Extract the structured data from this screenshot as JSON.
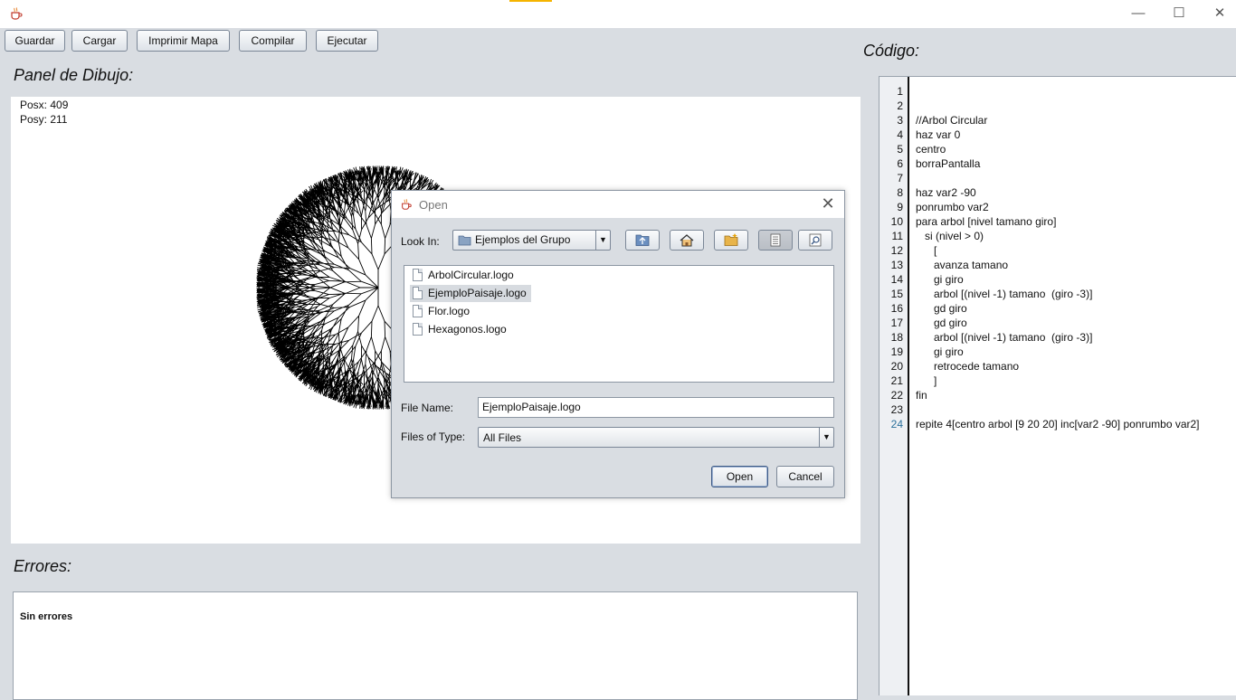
{
  "window": {
    "icon": "java-cup-icon",
    "controls": {
      "minimize": "—",
      "maximize": "☐",
      "close": "✕"
    }
  },
  "toolbar": {
    "guardar": "Guardar",
    "cargar": "Cargar",
    "imprimir": "Imprimir Mapa",
    "compilar": "Compilar",
    "ejecutar": "Ejecutar"
  },
  "drawing": {
    "title": "Panel de Dibujo:",
    "posx": "Posx: 409",
    "posy": "Posy: 211"
  },
  "errors": {
    "title": "Errores:",
    "message": "Sin errores"
  },
  "code": {
    "title": "Código:",
    "lines": [
      {
        "n": "1",
        "text": ""
      },
      {
        "n": "2",
        "text": ""
      },
      {
        "n": "3",
        "text": "//Arbol Circular"
      },
      {
        "n": "4",
        "text": "haz var 0"
      },
      {
        "n": "5",
        "text": "centro"
      },
      {
        "n": "6",
        "text": "borraPantalla"
      },
      {
        "n": "7",
        "text": ""
      },
      {
        "n": "8",
        "text": "haz var2 -90"
      },
      {
        "n": "9",
        "text": "ponrumbo var2"
      },
      {
        "n": "10",
        "text": "para arbol [nivel tamano giro]"
      },
      {
        "n": "11",
        "text": "   si (nivel > 0)"
      },
      {
        "n": "12",
        "text": "      ["
      },
      {
        "n": "13",
        "text": "      avanza tamano"
      },
      {
        "n": "14",
        "text": "      gi giro"
      },
      {
        "n": "15",
        "text": "      arbol [(nivel -1) tamano  (giro -3)]"
      },
      {
        "n": "16",
        "text": "      gd giro"
      },
      {
        "n": "17",
        "text": "      gd giro"
      },
      {
        "n": "18",
        "text": "      arbol [(nivel -1) tamano  (giro -3)]"
      },
      {
        "n": "19",
        "text": "      gi giro"
      },
      {
        "n": "20",
        "text": "      retrocede tamano"
      },
      {
        "n": "21",
        "text": "      ]"
      },
      {
        "n": "22",
        "text": "fin"
      },
      {
        "n": "23",
        "text": ""
      },
      {
        "n": "24",
        "text": "repite 4[centro arbol [9 20 20] inc[var2 -90] ponrumbo var2]"
      }
    ],
    "current_line": "24",
    "current_line_color": "#2a6f9a"
  },
  "dialog": {
    "title": "Open",
    "look_in_label": "Look In:",
    "look_in_value": "Ejemplos del Grupo",
    "files": [
      {
        "name": "ArbolCircular.logo",
        "selected": false
      },
      {
        "name": "EjemploPaisaje.logo",
        "selected": true
      },
      {
        "name": "Flor.logo",
        "selected": false
      },
      {
        "name": "Hexagonos.logo",
        "selected": false
      }
    ],
    "file_name_label": "File Name:",
    "file_name_value": "EjemploPaisaje.logo",
    "files_of_type_label": "Files of Type:",
    "files_of_type_value": "All Files",
    "open_button": "Open",
    "cancel_button": "Cancel"
  }
}
